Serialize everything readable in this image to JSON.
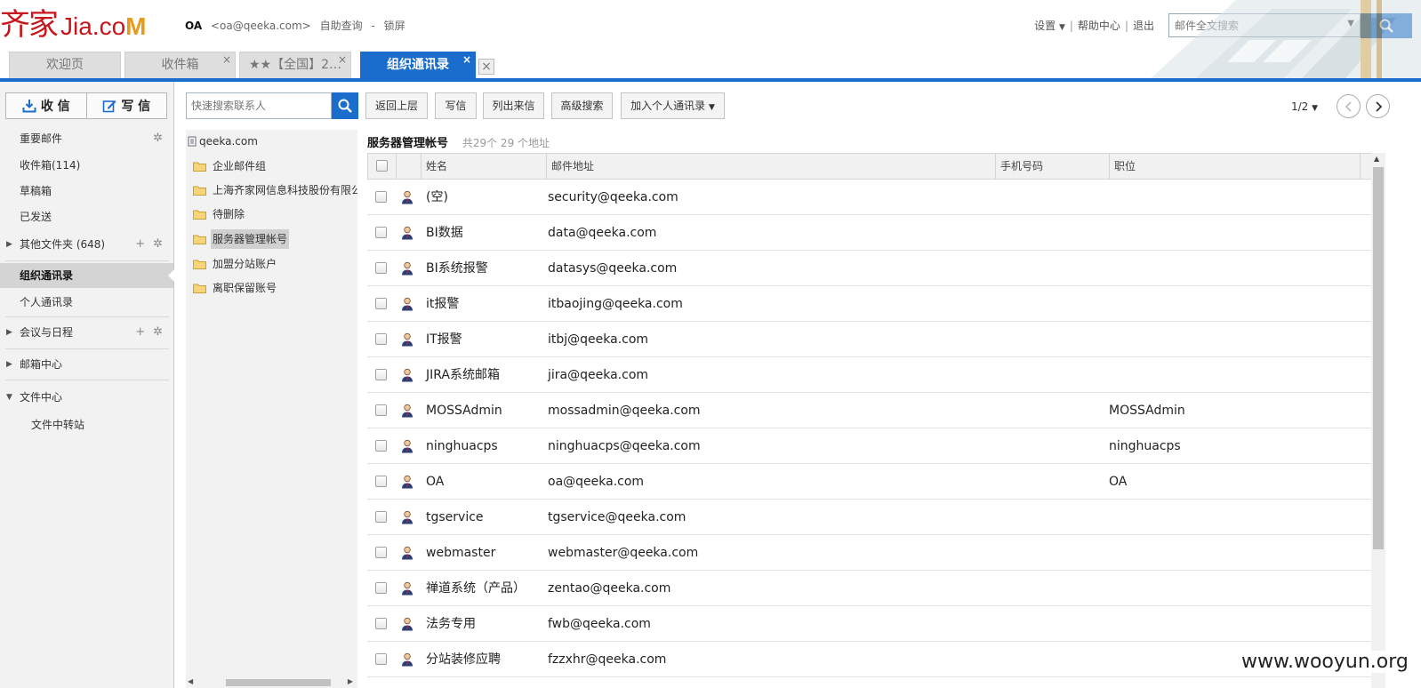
{
  "logo": {
    "cn": "齐家",
    "en": "Jia.co",
    "m": "M"
  },
  "user": {
    "name": "OA",
    "email": "<oa@qeeka.com>",
    "self_query": "自助查询",
    "dash": "-",
    "lock": "锁屏"
  },
  "top_links": {
    "settings": "设置",
    "help": "帮助中心",
    "logout": "退出",
    "sep": "|"
  },
  "search": {
    "placeholder": "邮件全文搜索"
  },
  "tabs": [
    {
      "label": "欢迎页",
      "active": false,
      "closable": false
    },
    {
      "label": "收件箱",
      "active": false,
      "closable": true
    },
    {
      "label": "★★【全国】2…",
      "active": false,
      "closable": true
    },
    {
      "label": "组织通讯录",
      "active": true,
      "closable": true
    }
  ],
  "tab_close_glyph": "×",
  "compose": {
    "receive": "收 信",
    "write": "写 信"
  },
  "sidebar": {
    "important": "重要邮件",
    "inbox": "收件箱(114)",
    "drafts": "草稿箱",
    "sent": "已发送",
    "other_folders": "其他文件夹 (648)",
    "org_contacts": "组织通讯录",
    "personal_contacts": "个人通讯录",
    "meetings": "会议与日程",
    "mailbox_center": "邮箱中心",
    "file_center": "文件中心",
    "file_transfer": "文件中转站"
  },
  "toolbar": {
    "quick_search_placeholder": "快速搜索联系人",
    "back": "返回上层",
    "write": "写信",
    "list_mail": "列出来信",
    "advanced": "高级搜索",
    "add_personal": "加入个人通讯录"
  },
  "pager": {
    "text": "1/2"
  },
  "tree": {
    "root": "qeeka.com",
    "nodes": [
      {
        "label": "企业邮件组",
        "selected": false
      },
      {
        "label": "上海齐家网信息科技股份有限公",
        "selected": false
      },
      {
        "label": "待删除",
        "selected": false
      },
      {
        "label": "服务器管理帐号",
        "selected": true
      },
      {
        "label": "加盟分站账户",
        "selected": false
      },
      {
        "label": "离职保留账号",
        "selected": false
      }
    ]
  },
  "content": {
    "title": "服务器管理帐号",
    "count": "共29个 29 个地址",
    "columns": {
      "name": "姓名",
      "email": "邮件地址",
      "mobile": "手机号码",
      "position": "职位"
    },
    "rows": [
      {
        "name": "(空)",
        "email": "security@qeeka.com",
        "position": ""
      },
      {
        "name": "BI数据",
        "email": "data@qeeka.com",
        "position": ""
      },
      {
        "name": "BI系统报警",
        "email": "datasys@qeeka.com",
        "position": ""
      },
      {
        "name": "it报警",
        "email": "itbaojing@qeeka.com",
        "position": ""
      },
      {
        "name": "IT报警",
        "email": "itbj@qeeka.com",
        "position": ""
      },
      {
        "name": "JIRA系统邮箱",
        "email": "jira@qeeka.com",
        "position": ""
      },
      {
        "name": "MOSSAdmin",
        "email": "mossadmin@qeeka.com",
        "position": "MOSSAdmin"
      },
      {
        "name": "ninghuacps",
        "email": "ninghuacps@qeeka.com",
        "position": "ninghuacps"
      },
      {
        "name": "OA",
        "email": "oa@qeeka.com",
        "position": "OA"
      },
      {
        "name": "tgservice",
        "email": "tgservice@qeeka.com",
        "position": ""
      },
      {
        "name": "webmaster",
        "email": "webmaster@qeeka.com",
        "position": ""
      },
      {
        "name": "禅道系统（产品）",
        "email": "zentao@qeeka.com",
        "position": ""
      },
      {
        "name": "法务专用",
        "email": "fwb@qeeka.com",
        "position": ""
      },
      {
        "name": "分站装修应聘",
        "email": "fzzxhr@qeeka.com",
        "position": ""
      }
    ]
  },
  "watermark": "www.wooyun.org",
  "colors": {
    "brand_red": "#c8161d",
    "accent_blue": "#1a6dcc",
    "logo_orange": "#e79b1d"
  }
}
